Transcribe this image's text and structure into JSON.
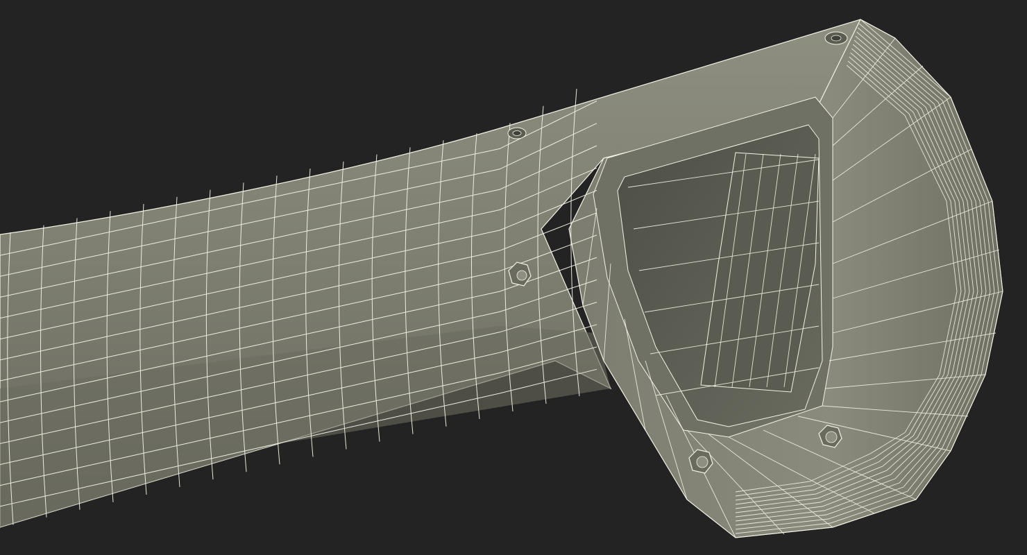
{
  "scene": {
    "subject": "wireframe-render",
    "colors": {
      "background": "#232323",
      "surface_light": "#8b8c7d",
      "surface_mid": "#7a7b6d",
      "surface_dark": "#5c5d52",
      "recess": "#3f403a",
      "wire": "#f4f4e6"
    }
  }
}
